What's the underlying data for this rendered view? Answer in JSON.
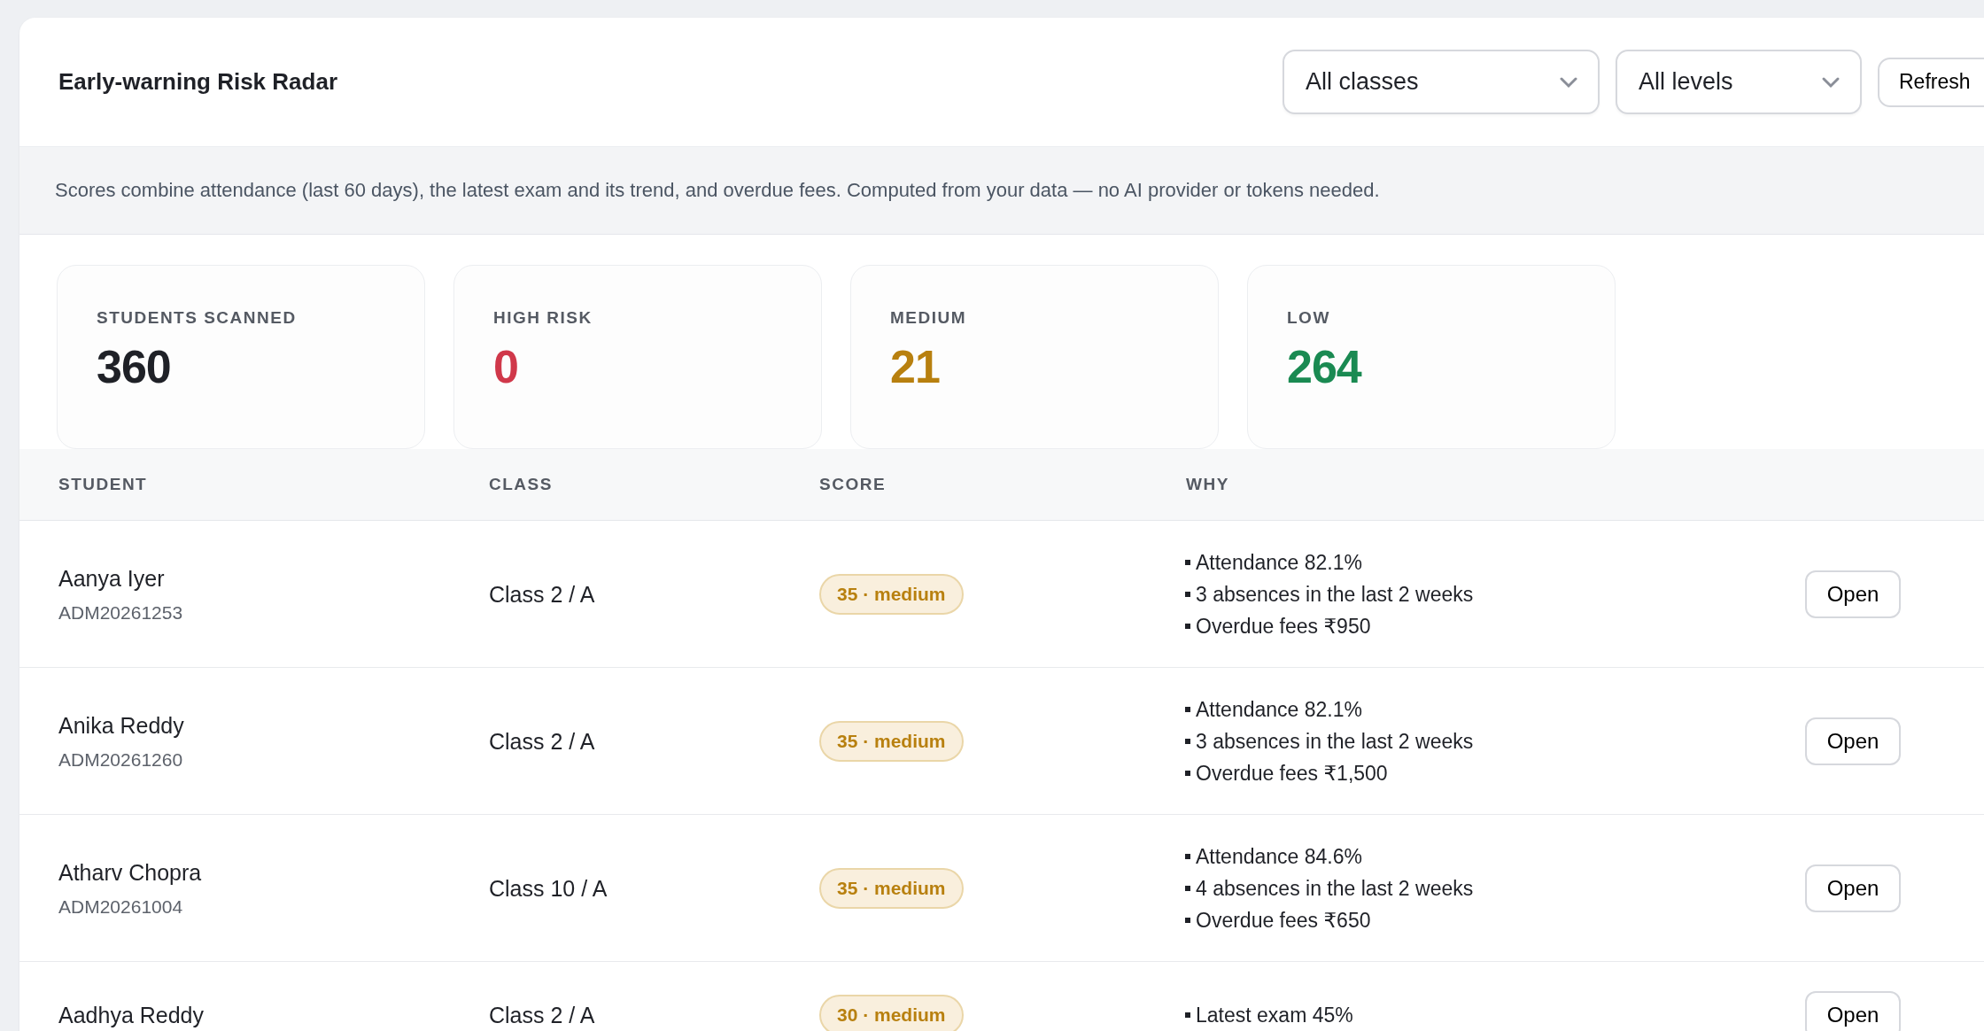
{
  "header": {
    "title": "Early-warning Risk Radar",
    "filters": [
      {
        "value": "All classes"
      },
      {
        "value": "All levels"
      }
    ],
    "refresh_button": "Refresh"
  },
  "info": "Scores combine attendance (last 60 days), the latest exam and its trend, and overdue fees. Computed from your data — no AI provider or tokens needed.",
  "stats": [
    {
      "label": "STUDENTS SCANNED",
      "value": "360",
      "kind": "total"
    },
    {
      "label": "HIGH RISK",
      "value": "0",
      "kind": "high"
    },
    {
      "label": "MEDIUM",
      "value": "21",
      "kind": "medium"
    },
    {
      "label": "LOW",
      "value": "264",
      "kind": "low"
    }
  ],
  "table": {
    "columns": [
      "STUDENT",
      "CLASS",
      "SCORE",
      "WHY"
    ],
    "rows": [
      {
        "name": "Aanya Iyer",
        "admission": "ADM20261253",
        "class": "Class 2 / A",
        "score": "35 · medium",
        "reasons": [
          "Attendance 82.1%",
          "3 absences in the last 2 weeks",
          "Overdue fees ₹950"
        ],
        "action": "Open"
      },
      {
        "name": "Anika Reddy",
        "admission": "ADM20261260",
        "class": "Class 2 / A",
        "score": "35 · medium",
        "reasons": [
          "Attendance 82.1%",
          "3 absences in the last 2 weeks",
          "Overdue fees ₹1,500"
        ],
        "action": "Open"
      },
      {
        "name": "Atharv Chopra",
        "admission": "ADM20261004",
        "class": "Class 10 / A",
        "score": "35 · medium",
        "reasons": [
          "Attendance 84.6%",
          "4 absences in the last 2 weeks",
          "Overdue fees ₹650"
        ],
        "action": "Open"
      },
      {
        "name": "Aadhya Reddy",
        "class": "Class 2 / A",
        "score": "30 · medium",
        "reasons": [
          "Latest exam 45%"
        ],
        "action": "Open"
      }
    ]
  }
}
